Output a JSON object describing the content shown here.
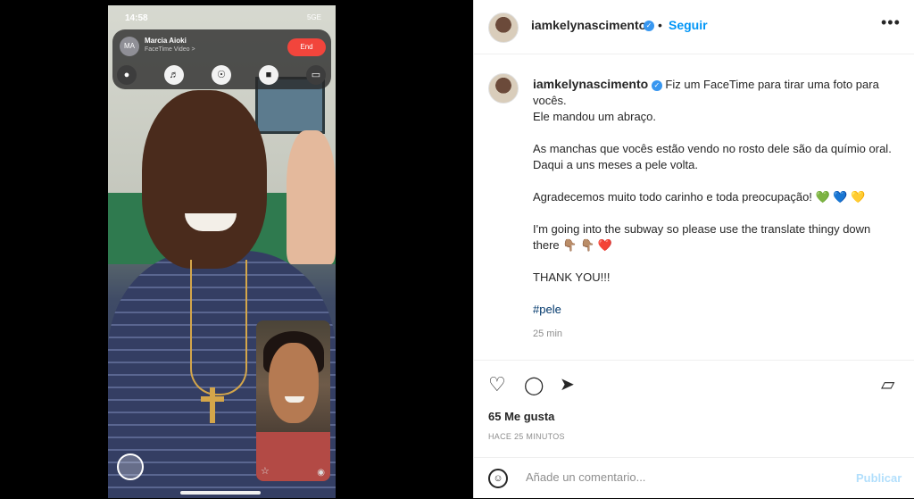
{
  "phone": {
    "time": "14:58",
    "network": "5GE",
    "facetime": {
      "initials": "MA",
      "caller": "Marcia Aioki",
      "subtitle": "FaceTime Video >",
      "end_label": "End"
    }
  },
  "post": {
    "username": "iamkelynascimento",
    "follow_label": "Seguir",
    "more_label": "•••",
    "caption": {
      "line1": "Fiz um FaceTime para tirar uma foto para vocês.",
      "line2": "Ele mandou um abraço.",
      "line3": "As manchas que vocês estão vendo no rosto dele são da químio oral. Daqui a uns meses a pele volta.",
      "line4": "Agradecemos muito todo carinho e toda preocupação! 💚 💙 💛",
      "line5": "I'm going into the subway so please use the translate thingy down there 👇🏽 👇🏽 ❤️",
      "line6": "THANK YOU!!!",
      "hashtag": "#pele"
    },
    "time_ago": "25 min",
    "likes": "65 Me gusta",
    "posted": "HACE 25 MINUTOS",
    "comment_placeholder": "Añade un comentario...",
    "publish_label": "Publicar"
  }
}
